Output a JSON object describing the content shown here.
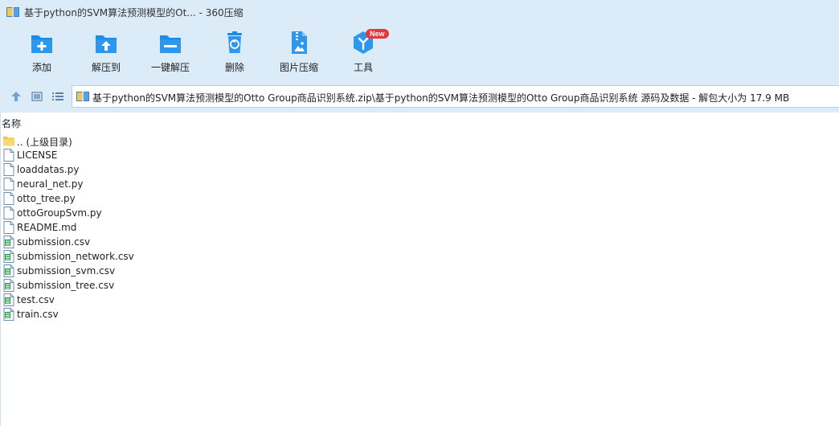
{
  "window": {
    "title": "基于python的SVM算法预测模型的Ot... - 360压缩"
  },
  "toolbar": {
    "items": [
      {
        "label": "添加",
        "icon": "add-folder-icon"
      },
      {
        "label": "解压到",
        "icon": "extract-to-icon"
      },
      {
        "label": "一键解压",
        "icon": "one-click-extract-icon"
      },
      {
        "label": "删除",
        "icon": "delete-icon"
      },
      {
        "label": "图片压缩",
        "icon": "image-compress-icon"
      },
      {
        "label": "工具",
        "icon": "tools-icon",
        "badge": "New"
      }
    ]
  },
  "address": {
    "path": "基于python的SVM算法预测模型的Otto Group商品识别系统.zip\\基于python的SVM算法预测模型的Otto Group商品识别系统 源码及数据 - 解包大小为 17.9 MB"
  },
  "list": {
    "column_name": "名称",
    "files": [
      {
        "name": ".. (上级目录)",
        "type": "folder"
      },
      {
        "name": "LICENSE",
        "type": "file"
      },
      {
        "name": "loaddatas.py",
        "type": "file"
      },
      {
        "name": "neural_net.py",
        "type": "file"
      },
      {
        "name": "otto_tree.py",
        "type": "file"
      },
      {
        "name": "ottoGroupSvm.py",
        "type": "file"
      },
      {
        "name": "README.md",
        "type": "file"
      },
      {
        "name": "submission.csv",
        "type": "csv"
      },
      {
        "name": "submission_network.csv",
        "type": "csv"
      },
      {
        "name": "submission_svm.csv",
        "type": "csv"
      },
      {
        "name": "submission_tree.csv",
        "type": "csv"
      },
      {
        "name": "test.csv",
        "type": "csv"
      },
      {
        "name": "train.csv",
        "type": "csv"
      }
    ]
  },
  "colors": {
    "chrome": "#dcebf8",
    "icon_blue": "#1e8ae6",
    "badge_red": "#e8343a"
  }
}
